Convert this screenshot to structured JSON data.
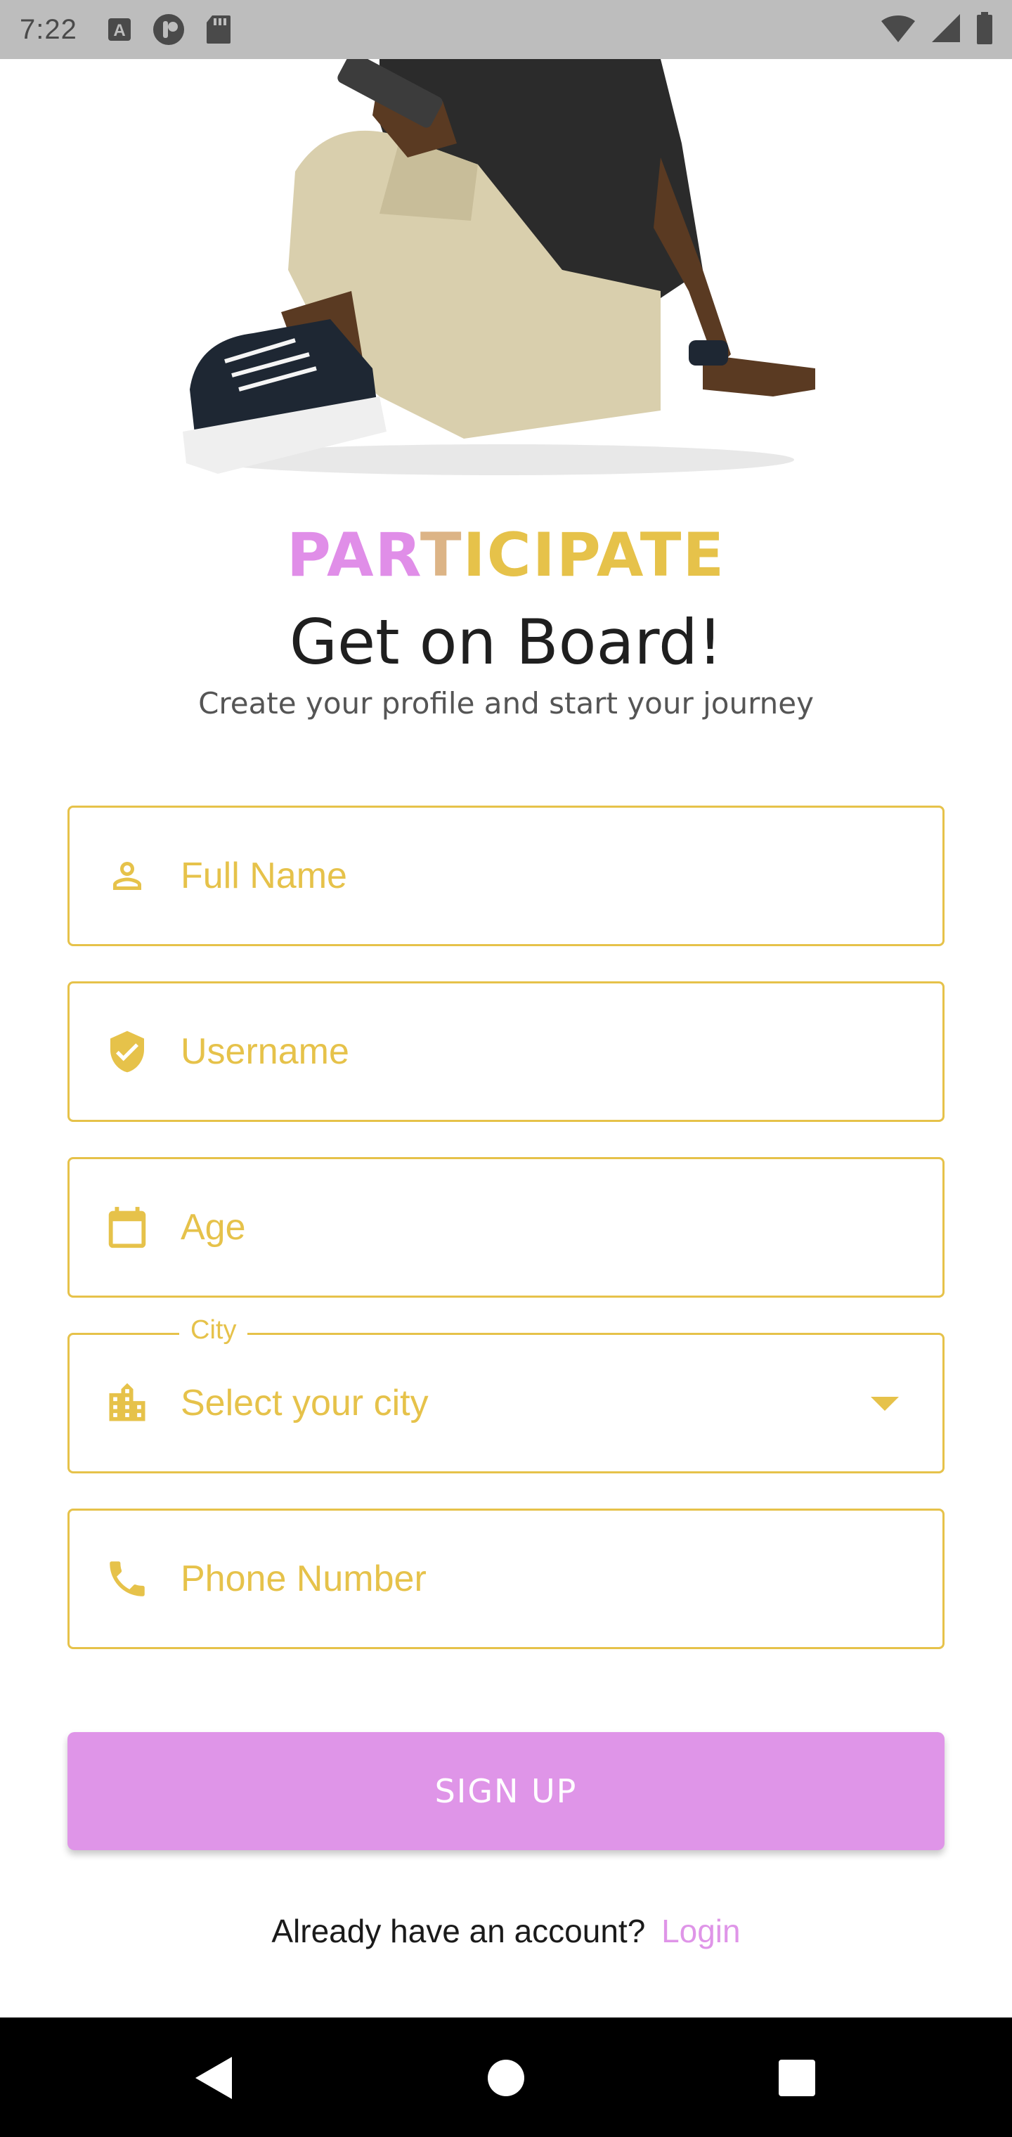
{
  "status_bar": {
    "time": "7:22",
    "icons_left": [
      "text-a-icon",
      "pocket-icon",
      "sd-card-icon"
    ],
    "icons_right": [
      "wifi-icon",
      "signal-icon",
      "battery-icon"
    ]
  },
  "hero": {
    "image": "person-sitting-with-phone-illustration"
  },
  "header": {
    "brand_part1": "PAR",
    "brand_part2": "T",
    "brand_part3": "ICIPATE",
    "title": "Get on Board!",
    "subtitle": "Create your profile and start your journey"
  },
  "form": {
    "full_name": {
      "placeholder": "Full Name",
      "icon": "person-icon"
    },
    "username": {
      "placeholder": "Username",
      "icon": "verified-shield-icon"
    },
    "age": {
      "placeholder": "Age",
      "icon": "calendar-icon"
    },
    "city": {
      "label": "City",
      "placeholder": "Select your city",
      "icon": "city-icon"
    },
    "phone": {
      "placeholder": "Phone Number",
      "icon": "phone-icon"
    }
  },
  "actions": {
    "signup_label": "SIGN UP",
    "login_prompt": "Already have an account?",
    "login_label": "Login"
  },
  "colors": {
    "accent_gold": "#e6c24a",
    "accent_pink": "#df95e8"
  }
}
